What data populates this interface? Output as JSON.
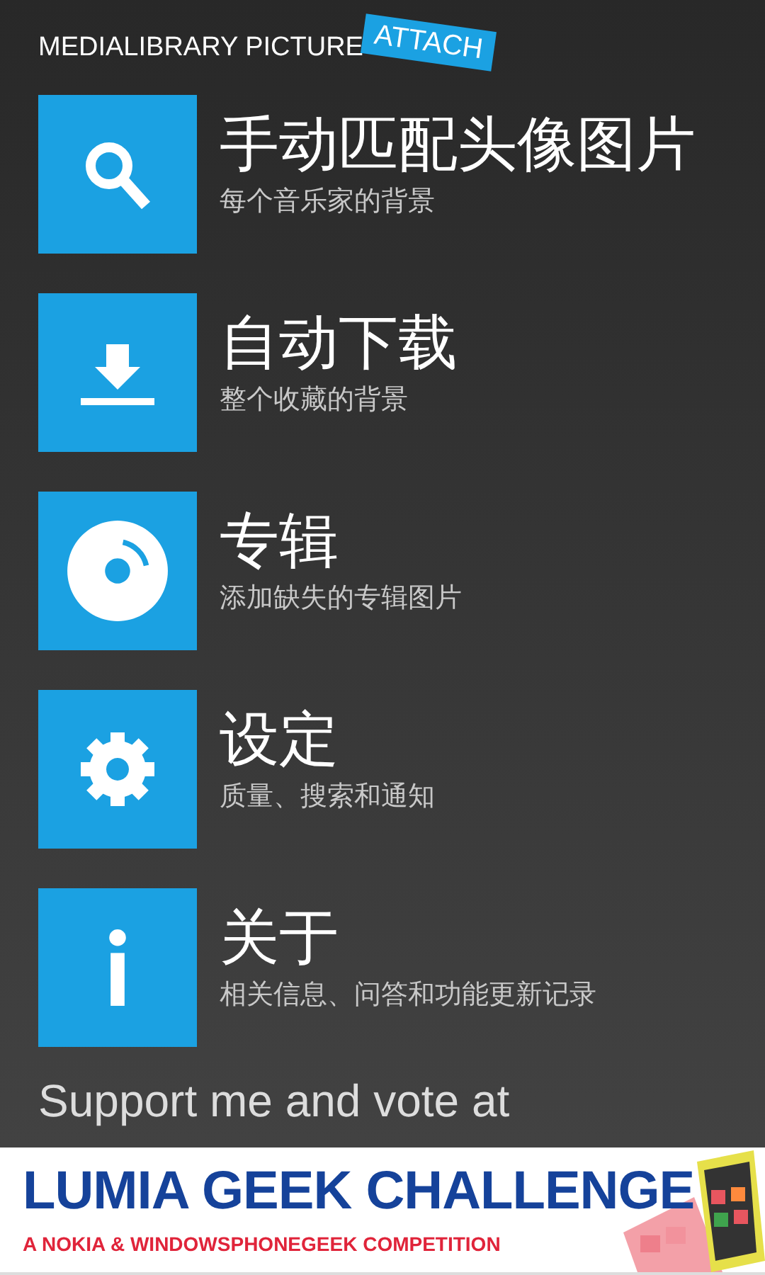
{
  "header": {
    "title": "MEDIALIBRARY PICTURE",
    "badge": "ATTACH"
  },
  "menu": [
    {
      "kind": "search",
      "title": "手动匹配头像图片",
      "subtitle": "每个音乐家的背景"
    },
    {
      "kind": "download",
      "title": "自动下载",
      "subtitle": "整个收藏的背景"
    },
    {
      "kind": "disc",
      "title": "专辑",
      "subtitle": "添加缺失的专辑图片"
    },
    {
      "kind": "gear",
      "title": "设定",
      "subtitle": "质量、搜索和通知"
    },
    {
      "kind": "info",
      "title": "关于",
      "subtitle": "相关信息、问答和功能更新记录"
    }
  ],
  "support": "Support me and vote at",
  "banner": {
    "title": "LUMIA GEEK CHALLENGE",
    "subtitle": "A NOKIA & WINDOWSPHONEGEEK COMPETITION",
    "kind": "picture"
  }
}
